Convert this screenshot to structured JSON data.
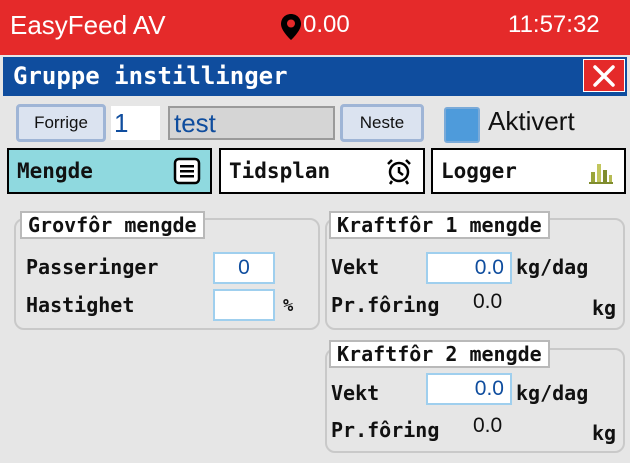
{
  "title_bar": {
    "app_title": "EasyFeed AV",
    "gps_value": "0.00",
    "clock": "11:57:32",
    "background": "#e52a2a"
  },
  "header": {
    "title": "Gruppe instillinger",
    "close_icon": "close-icon",
    "background": "#0f4d9e"
  },
  "nav": {
    "prev_label": "Forrige",
    "group_number": "1",
    "group_name": "test",
    "next_label": "Neste",
    "active_label": "Aktivert",
    "active_checked": false
  },
  "tabs": [
    {
      "label": "Mengde",
      "icon": "list-icon",
      "selected": true
    },
    {
      "label": "Tidsplan",
      "icon": "alarm-clock-icon",
      "selected": false
    },
    {
      "label": "Logger",
      "icon": "bar-chart-icon",
      "selected": false
    }
  ],
  "roughage": {
    "title": "Grovfôr mengde",
    "passes_label": "Passeringer",
    "passes_value": "0",
    "speed_label": "Hastighet",
    "speed_value": "",
    "speed_unit": "%"
  },
  "concentrate1": {
    "title": "Kraftfôr 1 mengde",
    "weight_label": "Vekt",
    "weight_value": "0.0",
    "weight_unit": "kg/dag",
    "per_feed_label": "Pr.fôring",
    "per_feed_value": "0.0",
    "per_feed_unit": "kg"
  },
  "concentrate2": {
    "title": "Kraftfôr 2 mengde",
    "weight_label": "Vekt",
    "weight_value": "0.0",
    "weight_unit": "kg/dag",
    "per_feed_label": "Pr.fôring",
    "per_feed_value": "0.0",
    "per_feed_unit": "kg"
  }
}
